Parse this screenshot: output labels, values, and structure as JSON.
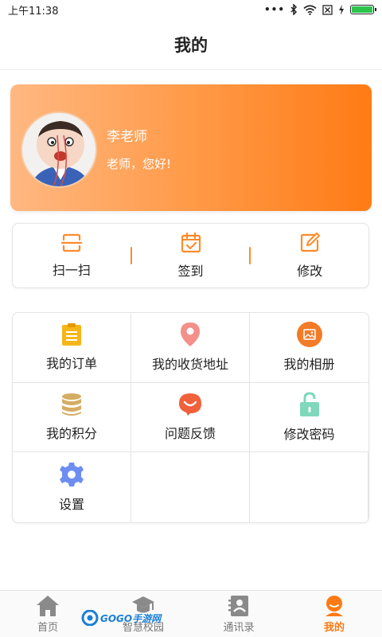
{
  "status_bar": {
    "time": "上午11:38",
    "icons": [
      "dots-icon",
      "bluetooth-icon",
      "wifi-icon",
      "no-sim-icon",
      "charging-icon",
      "battery-icon"
    ]
  },
  "header": {
    "title": "我的"
  },
  "profile": {
    "name": "李老师",
    "greeting": "老师，您好!",
    "avatar_icon": "cartoon-avatar"
  },
  "quick_actions": [
    {
      "label": "扫一扫",
      "icon": "scan-icon"
    },
    {
      "label": "签到",
      "icon": "calendar-check-icon"
    },
    {
      "label": "修改",
      "icon": "edit-icon"
    }
  ],
  "menu": [
    {
      "label": "我的订单",
      "icon": "order-clipboard-icon",
      "color": "#f6b619"
    },
    {
      "label": "我的收货地址",
      "icon": "location-pin-icon",
      "color": "#f48f89"
    },
    {
      "label": "我的相册",
      "icon": "photo-album-icon",
      "color": "#f27b27"
    },
    {
      "label": "我的积分",
      "icon": "coins-icon",
      "color": "#d5ac62"
    },
    {
      "label": "问题反馈",
      "icon": "feedback-icon",
      "color": "#f0603a"
    },
    {
      "label": "修改密码",
      "icon": "lock-icon",
      "color": "#7fd8b9"
    },
    {
      "label": "设置",
      "icon": "gear-icon",
      "color": "#6d8ef0"
    }
  ],
  "tabs": [
    {
      "label": "首页",
      "icon": "home-icon"
    },
    {
      "label": "智慧校园",
      "icon": "campus-icon"
    },
    {
      "label": "通讯录",
      "icon": "contacts-icon"
    },
    {
      "label": "我的",
      "icon": "profile-icon",
      "active": true
    }
  ],
  "watermark": {
    "text": "GOGO手游网"
  },
  "colors": {
    "accent": "#ff7a12",
    "card_start": "#ffb882",
    "card_end": "#ff7b15"
  }
}
